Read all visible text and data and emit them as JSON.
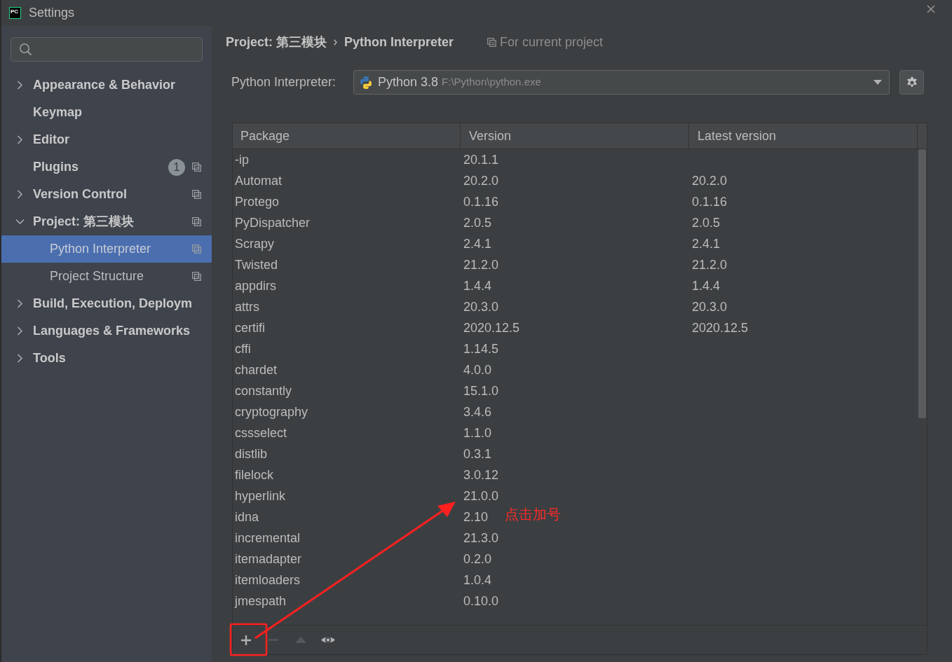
{
  "window": {
    "title": "Settings",
    "logo": "PC"
  },
  "sidebar": {
    "items": [
      {
        "label": "Appearance & Behavior",
        "expanded": false,
        "selected": false,
        "scope_icon": false
      },
      {
        "label": "Keymap",
        "selected": false,
        "scope_icon": false
      },
      {
        "label": "Editor",
        "expanded": false,
        "selected": false,
        "scope_icon": false
      },
      {
        "label": "Plugins",
        "selected": false,
        "badge": "1",
        "scope_icon": true
      },
      {
        "label": "Version Control",
        "expanded": false,
        "selected": false,
        "scope_icon": true
      },
      {
        "label": "Project: 第三模块",
        "expanded": true,
        "selected": false,
        "scope_icon": true,
        "children": [
          {
            "label": "Python Interpreter",
            "selected": true,
            "scope_icon": true
          },
          {
            "label": "Project Structure",
            "selected": false,
            "scope_icon": true
          }
        ]
      },
      {
        "label": "Build, Execution, Deploym",
        "expanded": false,
        "selected": false,
        "scope_icon": false
      },
      {
        "label": "Languages & Frameworks",
        "expanded": false,
        "selected": false,
        "scope_icon": false
      },
      {
        "label": "Tools",
        "expanded": false,
        "selected": false,
        "scope_icon": false
      }
    ]
  },
  "breadcrumb": [
    "Project: 第三模块",
    "Python Interpreter"
  ],
  "scope_note": "For current project",
  "interpreter": {
    "label": "Python Interpreter:",
    "name": "Python 3.8",
    "path": "F:\\Python\\python.exe"
  },
  "table": {
    "columns": [
      "Package",
      "Version",
      "Latest version"
    ],
    "rows": [
      {
        "package": "-ip",
        "version": "20.1.1"
      },
      {
        "package": "Automat",
        "version": "20.2.0",
        "latest": "20.2.0"
      },
      {
        "package": "Protego",
        "version": "0.1.16",
        "latest": "0.1.16"
      },
      {
        "package": "PyDispatcher",
        "version": "2.0.5",
        "latest": "2.0.5"
      },
      {
        "package": "Scrapy",
        "version": "2.4.1",
        "latest": "2.4.1"
      },
      {
        "package": "Twisted",
        "version": "21.2.0",
        "latest": "21.2.0"
      },
      {
        "package": "appdirs",
        "version": "1.4.4",
        "latest": "1.4.4"
      },
      {
        "package": "attrs",
        "version": "20.3.0",
        "latest": "20.3.0"
      },
      {
        "package": "certifi",
        "version": "2020.12.5",
        "latest": "2020.12.5"
      },
      {
        "package": "cffi",
        "version": "1.14.5"
      },
      {
        "package": "chardet",
        "version": "4.0.0"
      },
      {
        "package": "constantly",
        "version": "15.1.0"
      },
      {
        "package": "cryptography",
        "version": "3.4.6"
      },
      {
        "package": "cssselect",
        "version": "1.1.0"
      },
      {
        "package": "distlib",
        "version": "0.3.1"
      },
      {
        "package": "filelock",
        "version": "3.0.12"
      },
      {
        "package": "hyperlink",
        "version": "21.0.0"
      },
      {
        "package": "idna",
        "version": "2.10"
      },
      {
        "package": "incremental",
        "version": "21.3.0"
      },
      {
        "package": "itemadapter",
        "version": "0.2.0"
      },
      {
        "package": "itemloaders",
        "version": "1.0.4"
      },
      {
        "package": "jmespath",
        "version": "0.10.0"
      }
    ]
  },
  "toolbar": [
    {
      "kind": "add",
      "disabled": false
    },
    {
      "kind": "remove",
      "disabled": true
    },
    {
      "kind": "upgrade",
      "disabled": true
    },
    {
      "kind": "show",
      "disabled": false
    }
  ],
  "annotation": {
    "text": "点击加号"
  }
}
